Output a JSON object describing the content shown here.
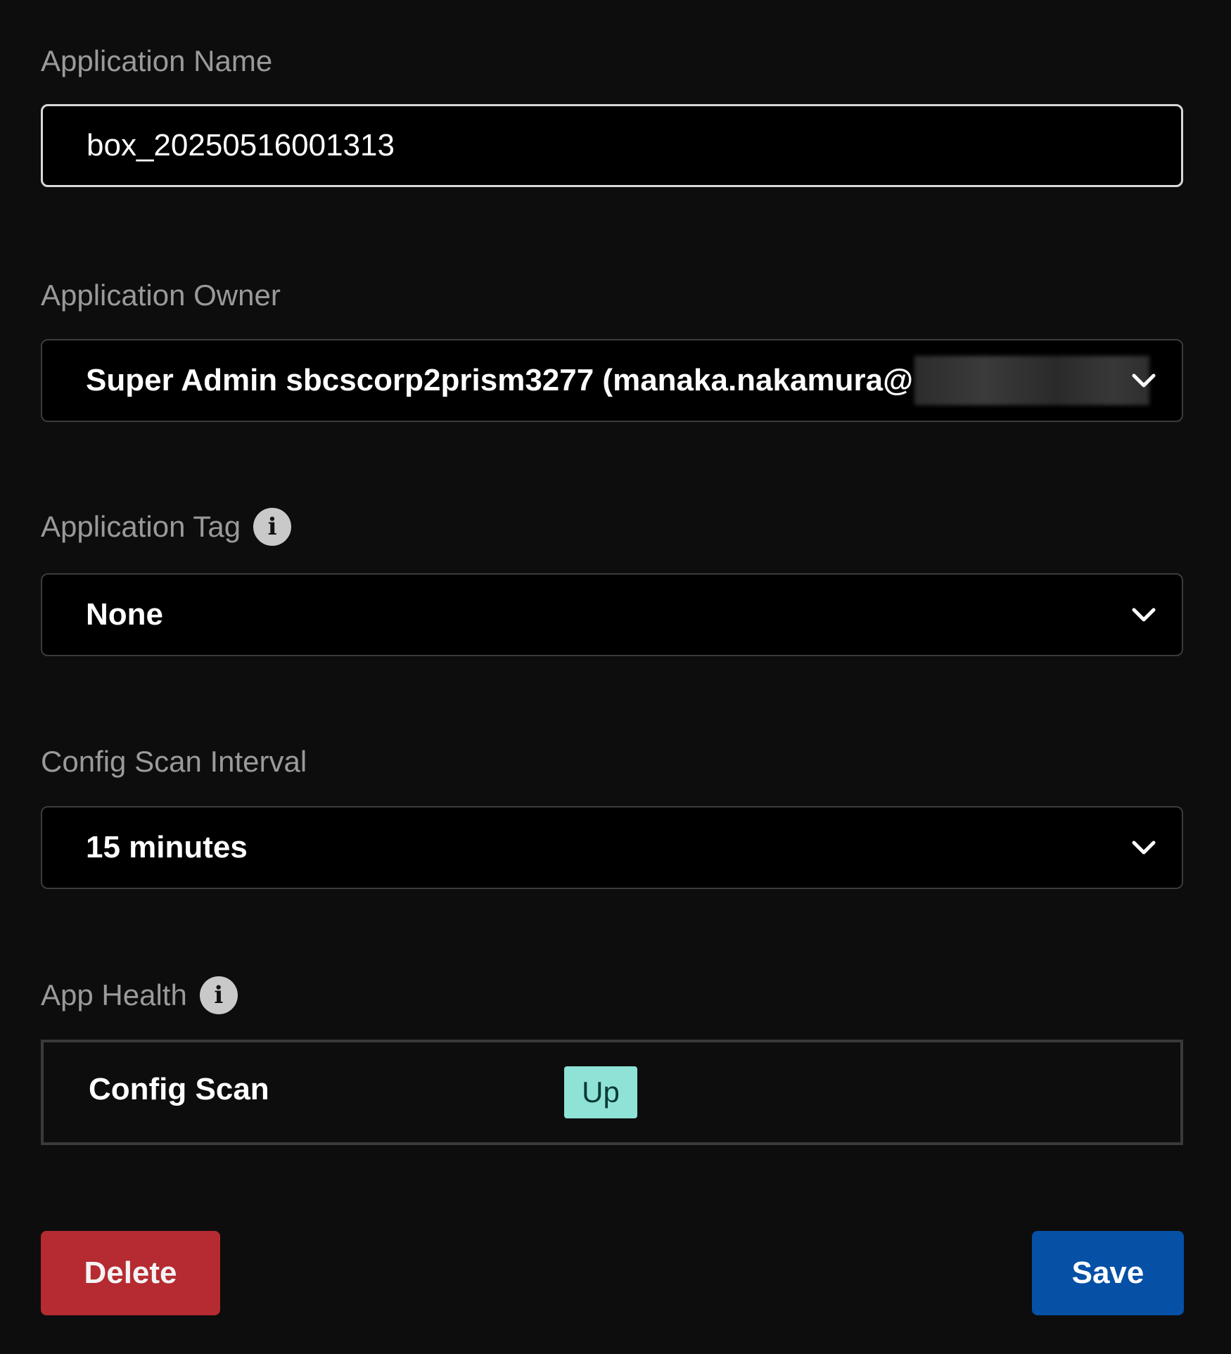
{
  "form": {
    "app_name": {
      "label": "Application Name",
      "value": "box_20250516001313"
    },
    "app_owner": {
      "label": "Application Owner",
      "value": "Super Admin sbcscorp2prism3277 (manaka.nakamura@"
    },
    "app_tag": {
      "label": "Application Tag",
      "value": "None"
    },
    "scan_interval": {
      "label": "Config Scan Interval",
      "value": "15 minutes"
    },
    "app_health": {
      "label": "App Health",
      "rows": [
        {
          "name": "Config Scan",
          "status": "Up"
        }
      ]
    }
  },
  "actions": {
    "delete_label": "Delete",
    "save_label": "Save"
  },
  "icons": {
    "info": "info-icon",
    "dropdown": "chevron-down-icon"
  },
  "colors": {
    "background": "#0d0d0d",
    "delete": "#b52b31",
    "save": "#0650a6",
    "status_up": "#8fe3d6"
  }
}
